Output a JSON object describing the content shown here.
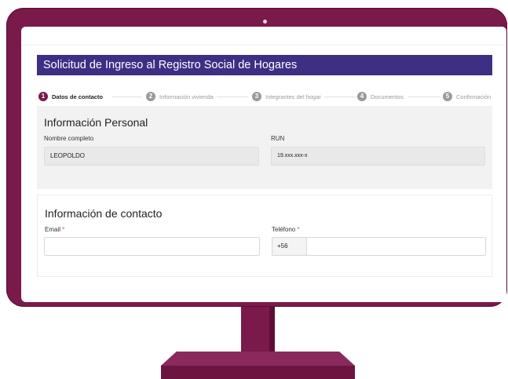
{
  "form": {
    "title": "Solicitud de Ingreso al Registro Social de Hogares"
  },
  "steps": [
    {
      "num": "1",
      "label": "Datos de contacto",
      "active": true
    },
    {
      "num": "2",
      "label": "Información vivienda",
      "active": false
    },
    {
      "num": "3",
      "label": "Integrantes del hogar",
      "active": false
    },
    {
      "num": "4",
      "label": "Documentos",
      "active": false
    },
    {
      "num": "5",
      "label": "Confirmación",
      "active": false
    }
  ],
  "personal": {
    "heading": "Información Personal",
    "name_label": "Nombre completo",
    "name_value": "LEOPOLDO",
    "run_label": "RUN",
    "run_value": "19.xxx.xxx-x"
  },
  "contact": {
    "heading": "Información de contacto",
    "email_label": "Email",
    "email_value": "",
    "phone_label": "Teléfono",
    "phone_prefix": "+56",
    "phone_value": "",
    "required_mark": "*"
  },
  "colors": {
    "accent": "#3e2e84",
    "monitor": "#7a1a4a",
    "required": "#d9534f"
  }
}
